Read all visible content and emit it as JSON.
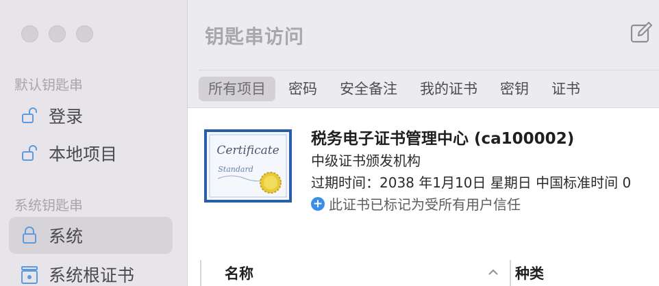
{
  "sidebar": {
    "section_default": "默认钥匙串",
    "default_items": [
      {
        "label": "登录",
        "icon": "unlocked-padlock-icon"
      },
      {
        "label": "本地项目",
        "icon": "unlocked-padlock-icon"
      }
    ],
    "section_system": "系统钥匙串",
    "system_items": [
      {
        "label": "系统",
        "icon": "locked-padlock-icon",
        "selected": true
      },
      {
        "label": "系统根证书",
        "icon": "cabinet-lock-icon"
      }
    ]
  },
  "header": {
    "title": "钥匙串访问",
    "compose_icon": "compose-icon"
  },
  "tabs": [
    {
      "label": "所有项目",
      "active": true
    },
    {
      "label": "密码"
    },
    {
      "label": "安全备注"
    },
    {
      "label": "我的证书"
    },
    {
      "label": "密钥"
    },
    {
      "label": "证书"
    }
  ],
  "certificate": {
    "name": "税务电子证书管理中心 (ca100002)",
    "issuer": "中级证书颁发机构",
    "expiry": "过期时间：2038 年1月10日 星期日 中国标准时间 0",
    "trust": "此证书已标记为受所有用户信任",
    "image_text": [
      "Certificate",
      "Standard"
    ]
  },
  "table": {
    "columns": [
      "名称",
      "种类"
    ]
  },
  "colors": {
    "accent": "#3a8ee6",
    "sidebar_bg": "#e7e5ea",
    "selected_bg": "#d6d4d8"
  }
}
